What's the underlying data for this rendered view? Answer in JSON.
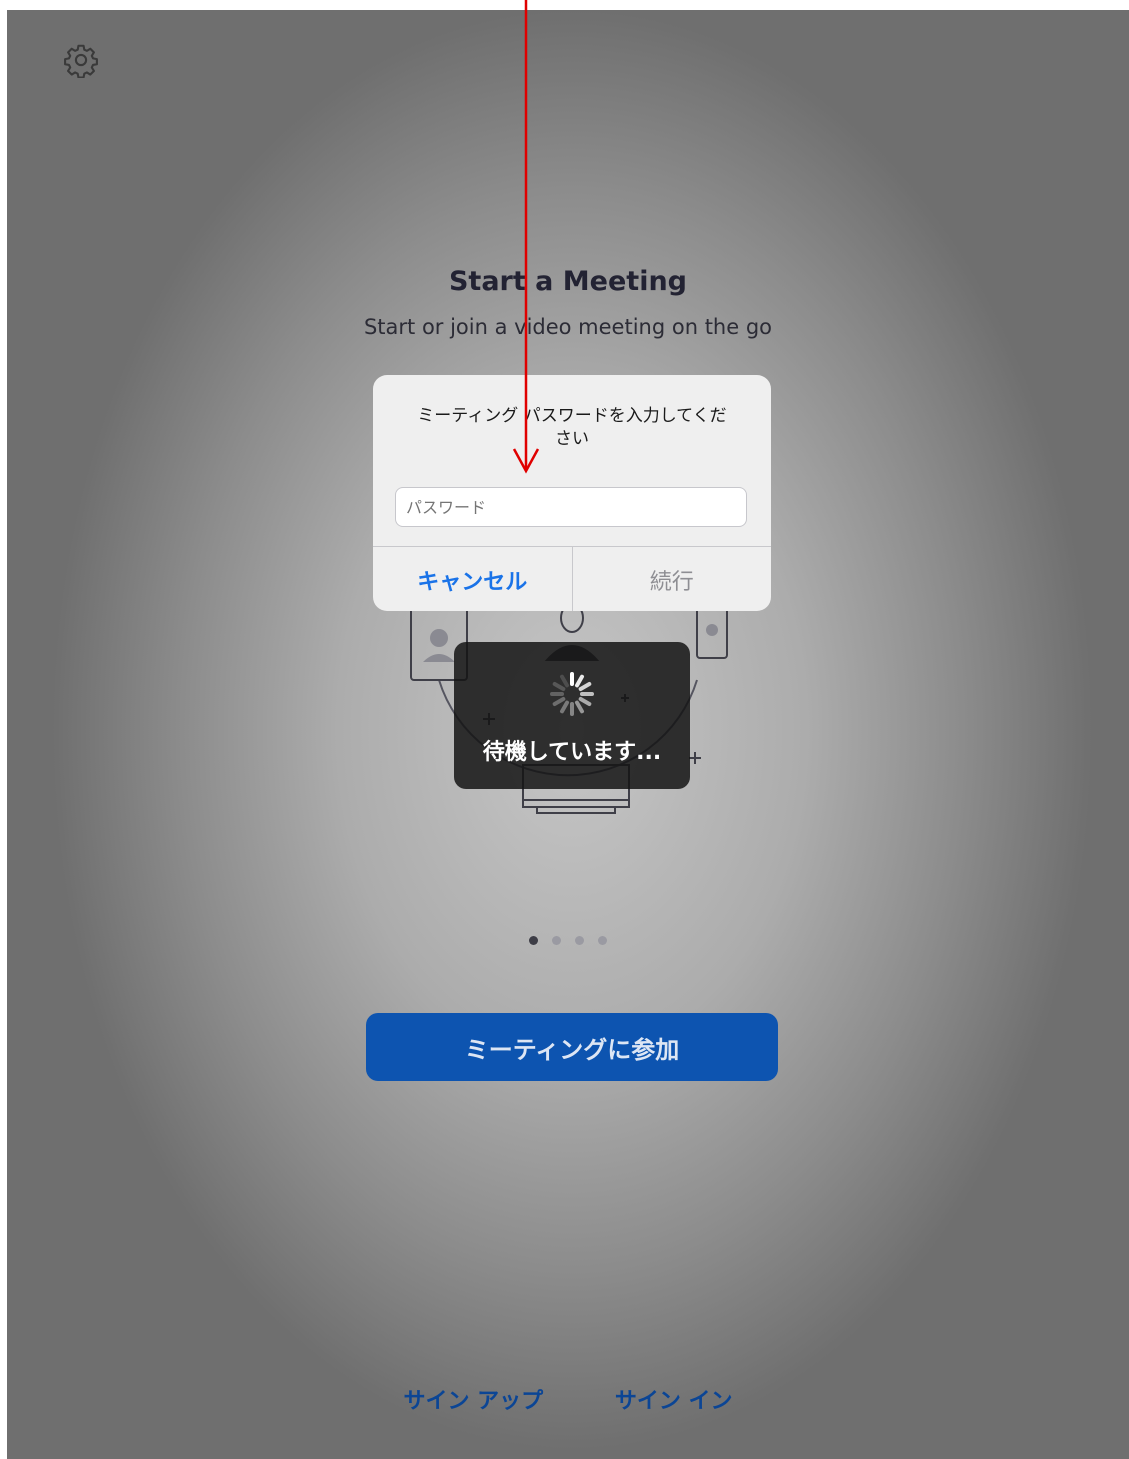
{
  "header": {
    "settings_icon": "gear-icon"
  },
  "hero": {
    "title": "Start a Meeting",
    "subtitle": "Start or join a video meeting on the go"
  },
  "dialog": {
    "message": "ミーティング パスワードを入力してください",
    "password_placeholder": "パスワード",
    "cancel_label": "キャンセル",
    "continue_label": "続行"
  },
  "loading": {
    "text": "待機しています..."
  },
  "pager": {
    "page_count": 4,
    "current_page": 1
  },
  "actions": {
    "join_label": "ミーティングに参加"
  },
  "footer": {
    "signup_label": "サイン アップ",
    "signin_label": "サイン イン"
  },
  "colors": {
    "join_button": "#0d54b0",
    "link": "#0b4595",
    "dialog_cancel": "#1a73e8",
    "annotation_arrow": "#e00000"
  }
}
